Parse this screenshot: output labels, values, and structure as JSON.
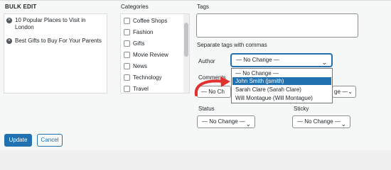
{
  "bulk_edit": {
    "title": "BULK EDIT",
    "posts": [
      {
        "line1": "10 Popular Places to Visit in",
        "line2": "London"
      },
      {
        "line1": "Best Gifts to Buy For Your Parents",
        "line2": ""
      }
    ],
    "remove_glyph": "×"
  },
  "categories": {
    "title": "Categories",
    "items": [
      "Coffee Shops",
      "Fashion",
      "Gifts",
      "Movie Review",
      "News",
      "Technology",
      "Travel"
    ]
  },
  "tags": {
    "title": "Tags",
    "hint": "Separate tags with commas"
  },
  "author": {
    "label": "Author",
    "selected": "— No Change —",
    "options": [
      "— No Change —",
      "John Smith (jsmith)",
      "Sarah Clare (Sarah Clare)",
      "Will Montague (Will Montague)"
    ],
    "highlighted_index": 1
  },
  "comments": {
    "label": "Comments",
    "left_partial": "— No Ch",
    "right_partial": "ge —"
  },
  "status": {
    "label": "Status",
    "selected": "— No Change —"
  },
  "sticky": {
    "label": "Sticky",
    "selected": "— No Change —"
  },
  "buttons": {
    "update": "Update",
    "cancel": "Cancel"
  },
  "icons": {
    "chevron": "chevron-down-icon",
    "annotation": "red-curved-arrow"
  },
  "colors": {
    "accent": "#2271b1",
    "arrow": "#e0312f"
  }
}
